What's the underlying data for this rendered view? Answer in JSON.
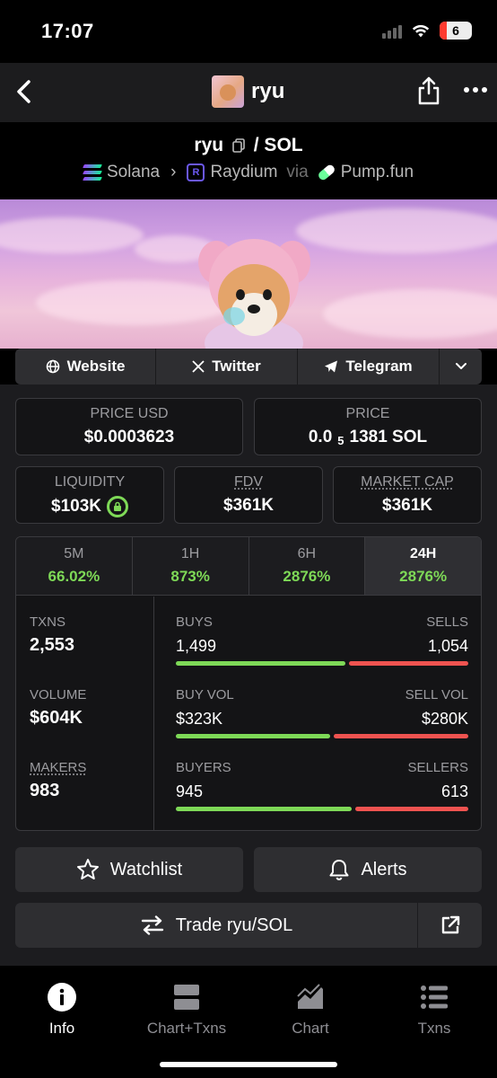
{
  "status": {
    "time": "17:07",
    "battery": "6"
  },
  "nav": {
    "title": "ryu"
  },
  "pair": {
    "base": "ryu",
    "quote": "/ SOL",
    "chain": "Solana",
    "dex": "Raydium",
    "via": "via",
    "launchpad": "Pump.fun"
  },
  "links": {
    "website": "Website",
    "twitter": "Twitter",
    "telegram": "Telegram"
  },
  "price": {
    "usd_label": "PRICE USD",
    "usd_value": "$0.0003623",
    "native_label": "PRICE",
    "native_prefix": "0.0",
    "native_zeros": "5",
    "native_digits": "1381 SOL"
  },
  "metrics": {
    "liquidity_label": "LIQUIDITY",
    "liquidity_value": "$103K",
    "fdv_label": "FDV",
    "fdv_value": "$361K",
    "mcap_label": "MARKET CAP",
    "mcap_value": "$361K"
  },
  "timeframes": [
    {
      "label": "5M",
      "change": "66.02%"
    },
    {
      "label": "1H",
      "change": "873%"
    },
    {
      "label": "6H",
      "change": "2876%"
    },
    {
      "label": "24H",
      "change": "2876%",
      "active": true
    }
  ],
  "stats": {
    "txns_label": "TXNS",
    "txns_value": "2,553",
    "volume_label": "VOLUME",
    "volume_value": "$604K",
    "makers_label": "MAKERS",
    "makers_value": "983",
    "buys_label": "BUYS",
    "buys_value": "1,499",
    "sells_label": "SELLS",
    "sells_value": "1,054",
    "buys_fraction": 0.587,
    "buyvol_label": "BUY VOL",
    "buyvol_value": "$323K",
    "sellvol_label": "SELL VOL",
    "sellvol_value": "$280K",
    "buyvol_fraction": 0.535,
    "buyers_label": "BUYERS",
    "buyers_value": "945",
    "sellers_label": "SELLERS",
    "sellers_value": "613",
    "buyers_fraction": 0.607
  },
  "actions": {
    "watchlist": "Watchlist",
    "alerts": "Alerts",
    "trade": "Trade ryu/SOL"
  },
  "tabbar": [
    {
      "label": "Info",
      "active": true
    },
    {
      "label": "Chart+Txns"
    },
    {
      "label": "Chart"
    },
    {
      "label": "Txns"
    }
  ],
  "colors": {
    "positive": "#7ed957",
    "negative": "#ef5350"
  }
}
